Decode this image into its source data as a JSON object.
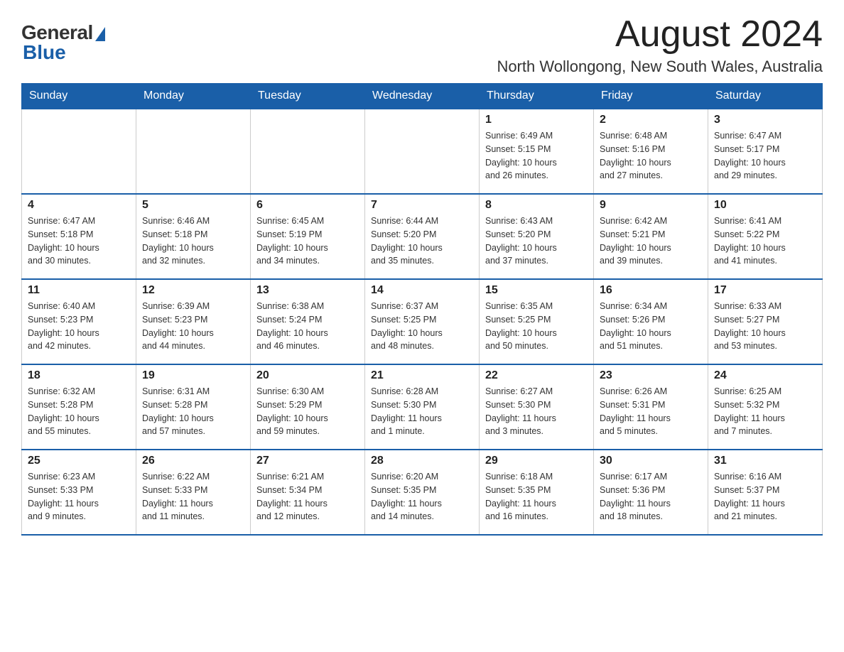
{
  "logo": {
    "general": "General",
    "blue": "Blue"
  },
  "header": {
    "month_title": "August 2024",
    "location": "North Wollongong, New South Wales, Australia"
  },
  "calendar": {
    "days_of_week": [
      "Sunday",
      "Monday",
      "Tuesday",
      "Wednesday",
      "Thursday",
      "Friday",
      "Saturday"
    ],
    "weeks": [
      [
        {
          "day": "",
          "info": ""
        },
        {
          "day": "",
          "info": ""
        },
        {
          "day": "",
          "info": ""
        },
        {
          "day": "",
          "info": ""
        },
        {
          "day": "1",
          "info": "Sunrise: 6:49 AM\nSunset: 5:15 PM\nDaylight: 10 hours\nand 26 minutes."
        },
        {
          "day": "2",
          "info": "Sunrise: 6:48 AM\nSunset: 5:16 PM\nDaylight: 10 hours\nand 27 minutes."
        },
        {
          "day": "3",
          "info": "Sunrise: 6:47 AM\nSunset: 5:17 PM\nDaylight: 10 hours\nand 29 minutes."
        }
      ],
      [
        {
          "day": "4",
          "info": "Sunrise: 6:47 AM\nSunset: 5:18 PM\nDaylight: 10 hours\nand 30 minutes."
        },
        {
          "day": "5",
          "info": "Sunrise: 6:46 AM\nSunset: 5:18 PM\nDaylight: 10 hours\nand 32 minutes."
        },
        {
          "day": "6",
          "info": "Sunrise: 6:45 AM\nSunset: 5:19 PM\nDaylight: 10 hours\nand 34 minutes."
        },
        {
          "day": "7",
          "info": "Sunrise: 6:44 AM\nSunset: 5:20 PM\nDaylight: 10 hours\nand 35 minutes."
        },
        {
          "day": "8",
          "info": "Sunrise: 6:43 AM\nSunset: 5:20 PM\nDaylight: 10 hours\nand 37 minutes."
        },
        {
          "day": "9",
          "info": "Sunrise: 6:42 AM\nSunset: 5:21 PM\nDaylight: 10 hours\nand 39 minutes."
        },
        {
          "day": "10",
          "info": "Sunrise: 6:41 AM\nSunset: 5:22 PM\nDaylight: 10 hours\nand 41 minutes."
        }
      ],
      [
        {
          "day": "11",
          "info": "Sunrise: 6:40 AM\nSunset: 5:23 PM\nDaylight: 10 hours\nand 42 minutes."
        },
        {
          "day": "12",
          "info": "Sunrise: 6:39 AM\nSunset: 5:23 PM\nDaylight: 10 hours\nand 44 minutes."
        },
        {
          "day": "13",
          "info": "Sunrise: 6:38 AM\nSunset: 5:24 PM\nDaylight: 10 hours\nand 46 minutes."
        },
        {
          "day": "14",
          "info": "Sunrise: 6:37 AM\nSunset: 5:25 PM\nDaylight: 10 hours\nand 48 minutes."
        },
        {
          "day": "15",
          "info": "Sunrise: 6:35 AM\nSunset: 5:25 PM\nDaylight: 10 hours\nand 50 minutes."
        },
        {
          "day": "16",
          "info": "Sunrise: 6:34 AM\nSunset: 5:26 PM\nDaylight: 10 hours\nand 51 minutes."
        },
        {
          "day": "17",
          "info": "Sunrise: 6:33 AM\nSunset: 5:27 PM\nDaylight: 10 hours\nand 53 minutes."
        }
      ],
      [
        {
          "day": "18",
          "info": "Sunrise: 6:32 AM\nSunset: 5:28 PM\nDaylight: 10 hours\nand 55 minutes."
        },
        {
          "day": "19",
          "info": "Sunrise: 6:31 AM\nSunset: 5:28 PM\nDaylight: 10 hours\nand 57 minutes."
        },
        {
          "day": "20",
          "info": "Sunrise: 6:30 AM\nSunset: 5:29 PM\nDaylight: 10 hours\nand 59 minutes."
        },
        {
          "day": "21",
          "info": "Sunrise: 6:28 AM\nSunset: 5:30 PM\nDaylight: 11 hours\nand 1 minute."
        },
        {
          "day": "22",
          "info": "Sunrise: 6:27 AM\nSunset: 5:30 PM\nDaylight: 11 hours\nand 3 minutes."
        },
        {
          "day": "23",
          "info": "Sunrise: 6:26 AM\nSunset: 5:31 PM\nDaylight: 11 hours\nand 5 minutes."
        },
        {
          "day": "24",
          "info": "Sunrise: 6:25 AM\nSunset: 5:32 PM\nDaylight: 11 hours\nand 7 minutes."
        }
      ],
      [
        {
          "day": "25",
          "info": "Sunrise: 6:23 AM\nSunset: 5:33 PM\nDaylight: 11 hours\nand 9 minutes."
        },
        {
          "day": "26",
          "info": "Sunrise: 6:22 AM\nSunset: 5:33 PM\nDaylight: 11 hours\nand 11 minutes."
        },
        {
          "day": "27",
          "info": "Sunrise: 6:21 AM\nSunset: 5:34 PM\nDaylight: 11 hours\nand 12 minutes."
        },
        {
          "day": "28",
          "info": "Sunrise: 6:20 AM\nSunset: 5:35 PM\nDaylight: 11 hours\nand 14 minutes."
        },
        {
          "day": "29",
          "info": "Sunrise: 6:18 AM\nSunset: 5:35 PM\nDaylight: 11 hours\nand 16 minutes."
        },
        {
          "day": "30",
          "info": "Sunrise: 6:17 AM\nSunset: 5:36 PM\nDaylight: 11 hours\nand 18 minutes."
        },
        {
          "day": "31",
          "info": "Sunrise: 6:16 AM\nSunset: 5:37 PM\nDaylight: 11 hours\nand 21 minutes."
        }
      ]
    ]
  }
}
